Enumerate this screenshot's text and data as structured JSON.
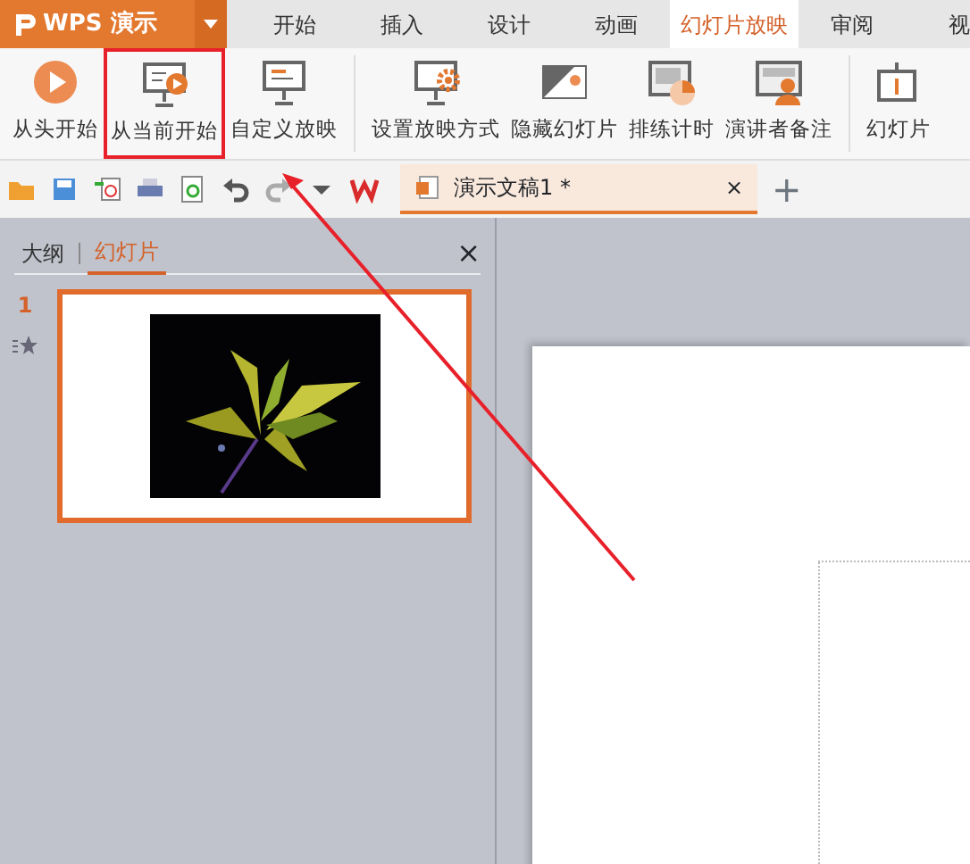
{
  "app_button": {
    "label": "WPS 演示"
  },
  "tabs": [
    {
      "label": "开始",
      "selected": false
    },
    {
      "label": "插入",
      "selected": false
    },
    {
      "label": "设计",
      "selected": false
    },
    {
      "label": "动画",
      "selected": false
    },
    {
      "label": "幻灯片放映",
      "selected": true
    },
    {
      "label": "审阅",
      "selected": false
    },
    {
      "label": "视",
      "selected": false
    }
  ],
  "ribbon": [
    {
      "kind": "play",
      "label": "从头开始",
      "highlighted": false
    },
    {
      "kind": "screen-play",
      "label": "从当前开始",
      "highlighted": true
    },
    {
      "kind": "screen",
      "label": "自定义放映",
      "highlighted": false
    },
    {
      "kind": "screen-gear",
      "label": "设置放映方式",
      "highlighted": false,
      "group_start": true
    },
    {
      "kind": "hide",
      "label": "隐藏幻灯片",
      "highlighted": false
    },
    {
      "kind": "timer",
      "label": "排练计时",
      "highlighted": false
    },
    {
      "kind": "presenter",
      "label": "演讲者备注",
      "highlighted": false
    },
    {
      "kind": "slide-number",
      "label": "幻灯片",
      "highlighted": false,
      "group_start": true
    }
  ],
  "document_tab": {
    "title": "演示文稿1 *",
    "close": "×"
  },
  "new_tab": "+",
  "panel": {
    "tabs": [
      {
        "label": "大纲",
        "selected": false
      },
      {
        "label": "幻灯片",
        "selected": true
      }
    ],
    "close": "×",
    "slides": [
      {
        "number": "1",
        "selected": true
      }
    ]
  }
}
